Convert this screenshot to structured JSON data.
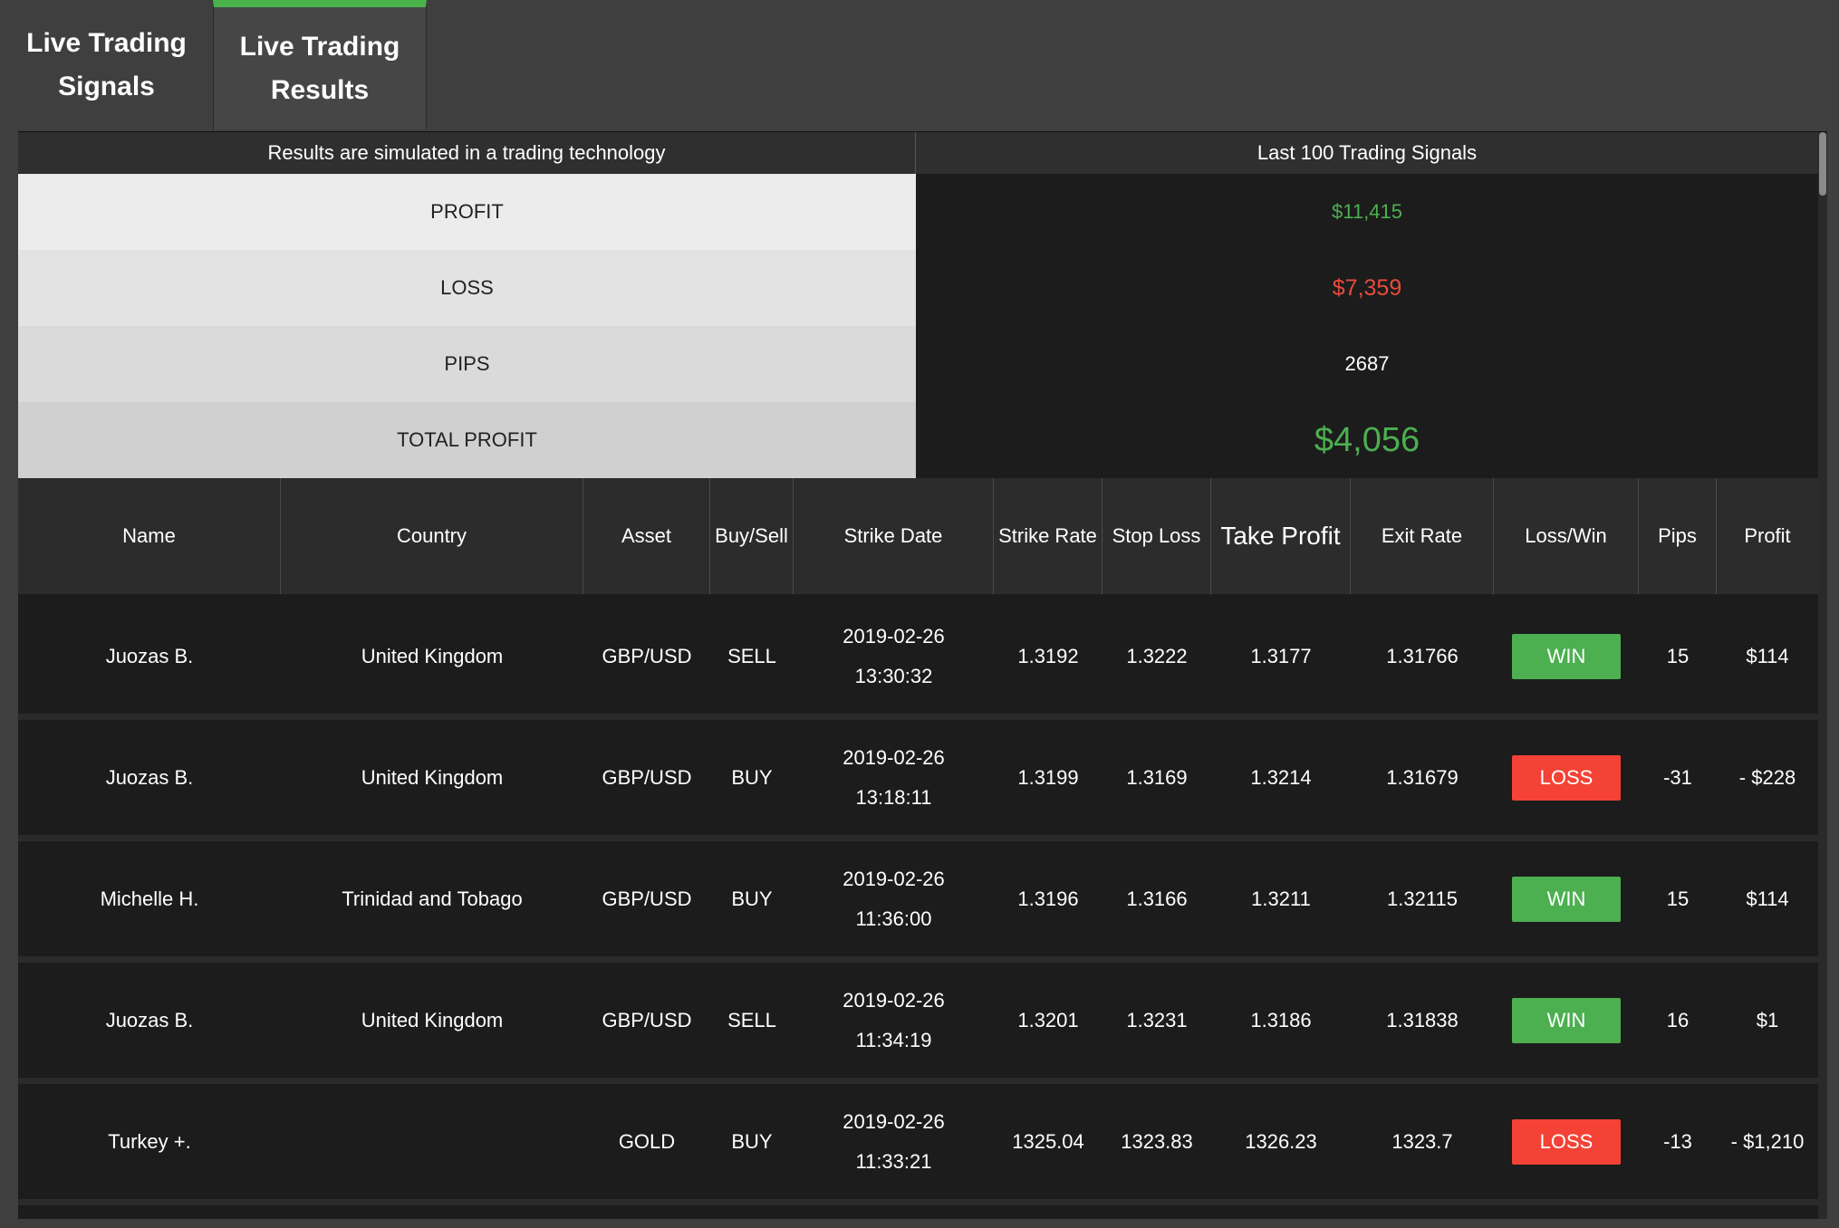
{
  "tabs": [
    {
      "label": "Live Trading Signals"
    },
    {
      "label": "Live Trading Results"
    }
  ],
  "summary": {
    "left_header": "Results are simulated in a trading technology",
    "right_header": "Last 100 Trading Signals",
    "rows": [
      {
        "label": "PROFIT",
        "value": "$11,415"
      },
      {
        "label": "LOSS",
        "value": "$7,359"
      },
      {
        "label": "PIPS",
        "value": "2687"
      },
      {
        "label": "TOTAL PROFIT",
        "value": "$4,056"
      }
    ]
  },
  "table": {
    "headers": [
      "Name",
      "Country",
      "Asset",
      "Buy/Sell",
      "Strike Date",
      "Strike Rate",
      "Stop Loss",
      "Take Profit",
      "Exit Rate",
      "Loss/Win",
      "Pips",
      "Profit"
    ],
    "rows": [
      {
        "name": "Juozas B.",
        "country": "United Kingdom",
        "asset": "GBP/USD",
        "side": "SELL",
        "date": "2019-02-26",
        "time": "13:30:32",
        "strike": "1.3192",
        "stop": "1.3222",
        "take": "1.3177",
        "exit": "1.31766",
        "result": "WIN",
        "pips": "15",
        "profit": "$114"
      },
      {
        "name": "Juozas B.",
        "country": "United Kingdom",
        "asset": "GBP/USD",
        "side": "BUY",
        "date": "2019-02-26",
        "time": "13:18:11",
        "strike": "1.3199",
        "stop": "1.3169",
        "take": "1.3214",
        "exit": "1.31679",
        "result": "LOSS",
        "pips": "-31",
        "profit": "- $228"
      },
      {
        "name": "Michelle H.",
        "country": "Trinidad and Tobago",
        "asset": "GBP/USD",
        "side": "BUY",
        "date": "2019-02-26",
        "time": "11:36:00",
        "strike": "1.3196",
        "stop": "1.3166",
        "take": "1.3211",
        "exit": "1.32115",
        "result": "WIN",
        "pips": "15",
        "profit": "$114"
      },
      {
        "name": "Juozas B.",
        "country": "United Kingdom",
        "asset": "GBP/USD",
        "side": "SELL",
        "date": "2019-02-26",
        "time": "11:34:19",
        "strike": "1.3201",
        "stop": "1.3231",
        "take": "1.3186",
        "exit": "1.31838",
        "result": "WIN",
        "pips": "16",
        "profit": "$1"
      },
      {
        "name": "Turkey +.",
        "country": "",
        "asset": "GOLD",
        "side": "BUY",
        "date": "2019-02-26",
        "time": "11:33:21",
        "strike": "1325.04",
        "stop": "1323.83",
        "take": "1326.23",
        "exit": "1323.7",
        "result": "LOSS",
        "pips": "-13",
        "profit": "- $1,210"
      }
    ]
  },
  "colors": {
    "accent": "#49b24a",
    "win": "#4caf50",
    "loss": "#f44336",
    "loss_text": "#e74c3c"
  }
}
